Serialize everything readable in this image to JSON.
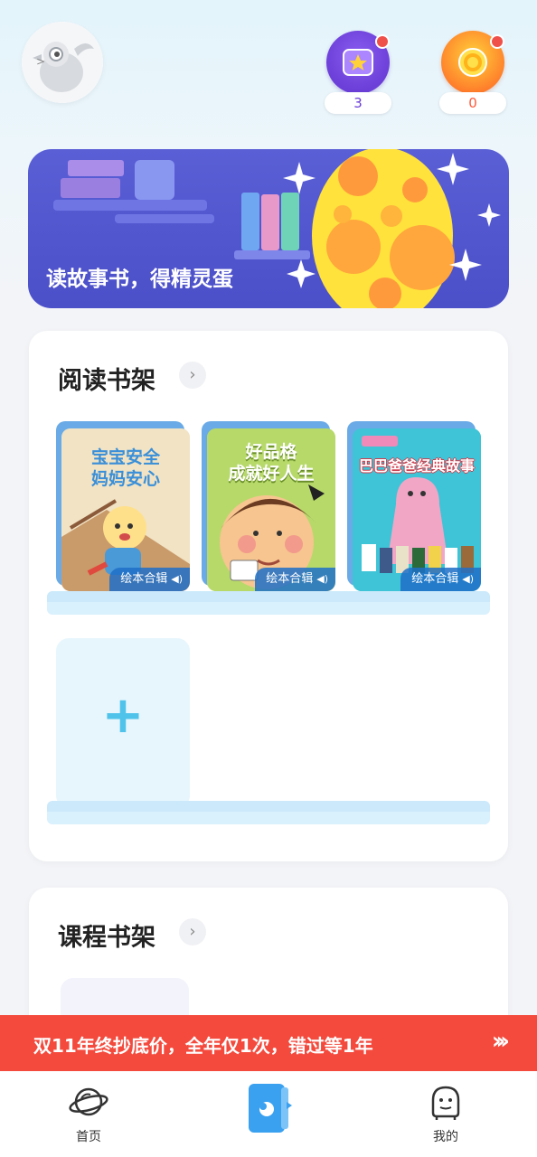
{
  "header": {
    "stars_count": "3",
    "coins_count": "0"
  },
  "banner": {
    "title": "读故事书，得精灵蛋"
  },
  "reading_shelf": {
    "title": "阅读书架",
    "chevron": "›",
    "books": [
      {
        "cover_title": "宝宝安全\n妈妈安心",
        "badge": "绘本合辑",
        "cover_color": "#f4e6c8",
        "title_color": "#3a8fd8"
      },
      {
        "cover_title": "好品格\n成就好人生",
        "badge": "绘本合辑",
        "cover_color": "#b9dc6a",
        "title_color": "#ffffff"
      },
      {
        "cover_title": "巴巴爸爸经典故事",
        "badge": "绘本合辑",
        "cover_color": "#3cc4d8",
        "title_color": "#ffffff"
      }
    ],
    "add_slot_icon": "+"
  },
  "course_shelf": {
    "title": "课程书架",
    "chevron": "›"
  },
  "promo": {
    "text": "双11年终抄底价，全年仅1次，错过等1年",
    "arrows": "›››"
  },
  "bottom_nav": {
    "items": [
      {
        "label": "首页",
        "icon": "planet-icon"
      },
      {
        "label": "",
        "icon": "bookshelf-icon"
      },
      {
        "label": "我的",
        "icon": "face-icon"
      }
    ]
  },
  "colors": {
    "brand_blue": "#3aa0f0",
    "promo_red": "#f44a3d",
    "banner_purple": "#4b4fc8"
  }
}
